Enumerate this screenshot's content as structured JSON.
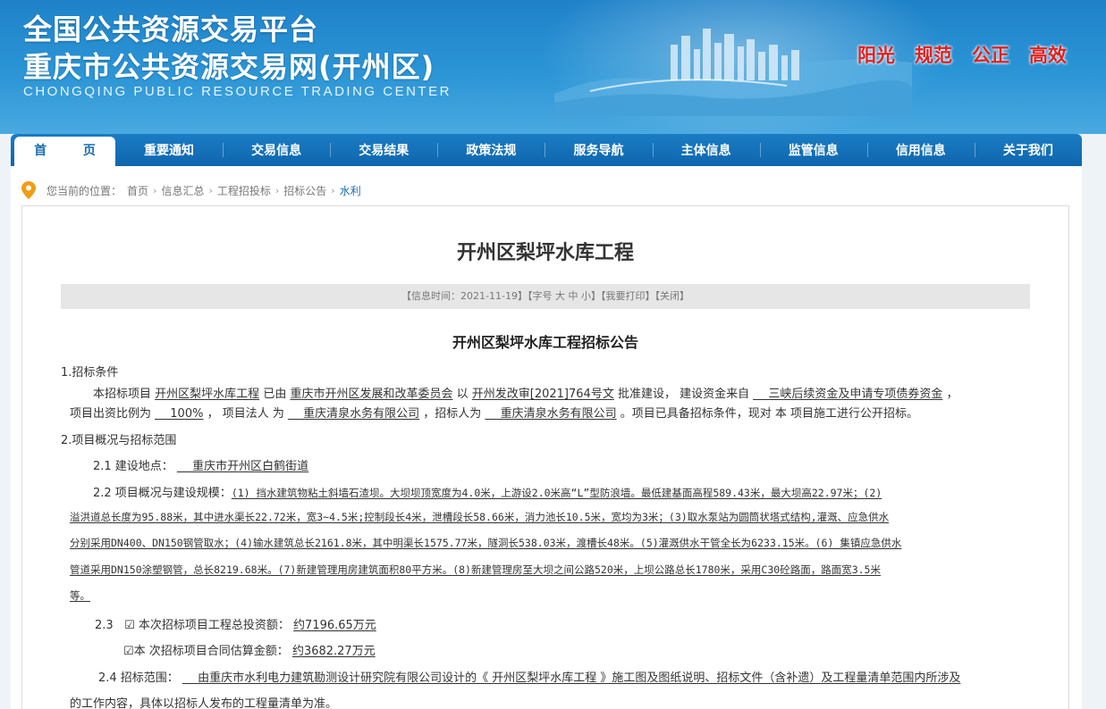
{
  "header": {
    "title_line1": "全国公共资源交易平台",
    "title_line2": "重庆市公共资源交易网(开州区)",
    "title_en": "CHONGQING PUBLIC RESOURCE TRADING CENTER",
    "slogans": [
      "阳光",
      "规范",
      "公正",
      "高效"
    ],
    "slogan_color": "#e02020",
    "brand_color": "#1a7cc4"
  },
  "nav": {
    "items": [
      "首 页",
      "重要通知",
      "交易信息",
      "交易结果",
      "政策法规",
      "服务导航",
      "主体信息",
      "监管信息",
      "信用信息",
      "关于我们"
    ],
    "active_index": 0
  },
  "breadcrumb": {
    "prefix": "您当前的位置：",
    "items": [
      "首页",
      "信息汇总",
      "工程招投标",
      "招标公告",
      "水利"
    ],
    "separator": "›"
  },
  "page": {
    "title": "开州区梨坪水库工程",
    "info": {
      "time_label": "【信息时间：",
      "time_value": "2021-11-19",
      "font_label": "】【字号",
      "font_large": "大",
      "font_medium": "中",
      "font_small": "小",
      "print": "】【我要打印】",
      "close": "【关闭】"
    }
  },
  "doc": {
    "title": "开州区梨坪水库工程招标公告",
    "s1_heading": "1.招标条件",
    "s1_l1_a": "本招标项目",
    "s1_l1_project": "开州区梨坪水库工程",
    "s1_l1_b": "已由",
    "s1_l1_approver": "重庆市开州区发展和改革委员会",
    "s1_l1_c": "以",
    "s1_l1_docno": "开州发改审[2021]764号文",
    "s1_l1_d": "批准建设， 建设资金来自",
    "s1_l1_fund": "__ 三峡后续资金及申请专项债券资金",
    "s1_l1_e": "，",
    "s1_l2_a": "项目出资比例为",
    "s1_l2_ratio": "__ 100%",
    "s1_l2_b": "，  项目法人 为",
    "s1_l2_legal": "__ 重庆清泉水务有限公司",
    "s1_l2_c": "，招标人为",
    "s1_l2_tenderer": "__ 重庆清泉水务有限公司",
    "s1_l2_d": "。项目已具备招标条件，现对 本 项目施工进行公开招标。",
    "s2_heading": "2.项目概况与招标范围",
    "s21_label": "2.1  建设地点：",
    "s21_value": "__ 重庆市开州区白鹤街道",
    "s22_label": "2.2  项目概况与建设规模：",
    "s22_l1": "(1) 挡水建筑物粘土斜墙石渣坝。大坝坝顶宽度为4.0米，上游设2.0米高“L”型防浪墙。最低建基面高程589.43米，最大坝高22.97米；(2)",
    "s22_l2": "溢洪道总长度为95.88米，其中进水渠长22.72米，宽3~4.5米;控制段长4米，泄槽段长58.66米，消力池长10.5米，宽均为3米；(3)取水泵站为圆筒状塔式结构,灌溉、应急供水",
    "s22_l3": "分别采用DN400、DN150钢管取水；(4)输水建筑总长2161.8米，其中明渠长1575.77米，隧洞长538.03米，渡槽长48米。(5)灌溉供水干管全长为6233.15米。(6) 集镇应急供水",
    "s22_l4": "管道采用DN150涂塑钢管，总长8219.68米。(7)新建管理用房建筑面积80平方米。(8)新建管理房至大坝之间公路520米，上坝公路总长1780米，采用C30砼路面，路面宽3.5米",
    "s22_l5": "等。",
    "s23_num": "2.3",
    "s23_a_check": "☑",
    "s23_a_label": "本次招标项目工程总投资额：",
    "s23_a_value": "约7196.65万元",
    "s23_b_check": "☑",
    "s23_b_label": "本  次招标项目合同估算金额：",
    "s23_b_value": "约3682.27万元",
    "s24_label": "2.4  招标范围：",
    "s24_l1": "__ 由重庆市水利电力建筑勘测设计研究院有限公司设计的《 开州区梨坪水库工程 》施工图及图纸说明、招标文件（含补遗）及工程量清单范围内所涉及",
    "s24_l2": "的工作内容，具体以招标人发布的工程量清单为准。"
  }
}
